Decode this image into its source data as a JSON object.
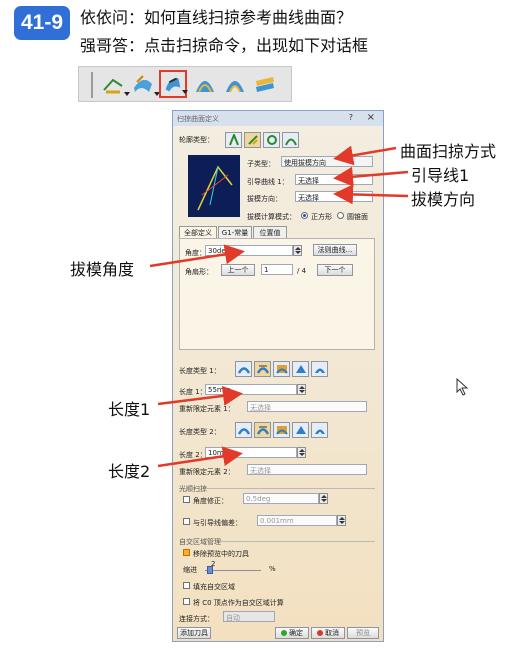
{
  "header": {
    "badge": "41-9",
    "question": "依依问：如何直线扫掠参考曲线曲面？",
    "answer": "强哥答：点击扫掠命令，出现如下对话框"
  },
  "toolbar": {
    "icons": [
      "sweep-line-icon",
      "sweep-surface-icon",
      "sweep-selected-icon",
      "fill-surface-icon",
      "multi-section-icon",
      "blend-icon"
    ],
    "selected_index": 2
  },
  "dialog": {
    "title": "扫掠曲面定义",
    "help": "?",
    "close": "×",
    "profile_type_label": "轮廓类型：",
    "subtype_label": "子类型：",
    "subtype_value": "使用拔模方向",
    "guide_curve_label": "引导曲线 1：",
    "guide_curve_value": "无选择",
    "draft_direction_label": "拔模方向：",
    "draft_direction_value": "无选择",
    "draft_mode_label": "拔模计算模式：",
    "radio_square": "正方形",
    "radio_cone": "圆锥面",
    "tabs": [
      "全部定义",
      "G1-常量",
      "位置值"
    ],
    "angle_label": "角度：",
    "angle_value": "30deg",
    "law_button": "法则曲线...",
    "angle_sector_label": "角扇形：",
    "prev_button": "上一个",
    "sector_value": "1",
    "sector_total": "/ 4",
    "next_button": "下一个",
    "length_type1_label": "长度类型 1：",
    "length1_label": "长度 1：",
    "length1_value": "55mm",
    "relimit1_label": "重新限定元素 1：",
    "relimit1_value": "无选择",
    "length_type2_label": "长度类型 2：",
    "length2_label": "长度 2：",
    "length2_value": "10mm",
    "relimit2_label": "重新限定元素 2：",
    "relimit2_value": "无选择",
    "smooth_section": "光顺扫掠",
    "angle_correct_label": "角度修正：",
    "angle_correct_value": "0.5deg",
    "deviation_label": "与引导线偏差：",
    "deviation_value": "0.001mm",
    "self_intersect_section": "自交区域管理",
    "remove_tools_label": "移除预览中的刀具",
    "taper_label": "缩进",
    "taper_value": "2",
    "percent": "%",
    "fill_label": "填充自交区域",
    "c0_label": "将 C0 顶点作为自交区域计算",
    "connect_label": "连接方式：",
    "connect_value": "自动",
    "add_tool": "添加刀具",
    "ok": "确定",
    "cancel": "取消",
    "preview": "预览"
  },
  "annotations": {
    "sweep_method": "曲面扫掠方式",
    "guide_line": "引导线1",
    "draft_direction": "拔模方向",
    "draft_angle": "拔模角度",
    "length1": "长度1",
    "length2": "长度2"
  },
  "colors": {
    "badge": "#2f6fd6",
    "arrow": "#e23a2a",
    "selection_frame": "#e23a2a"
  }
}
